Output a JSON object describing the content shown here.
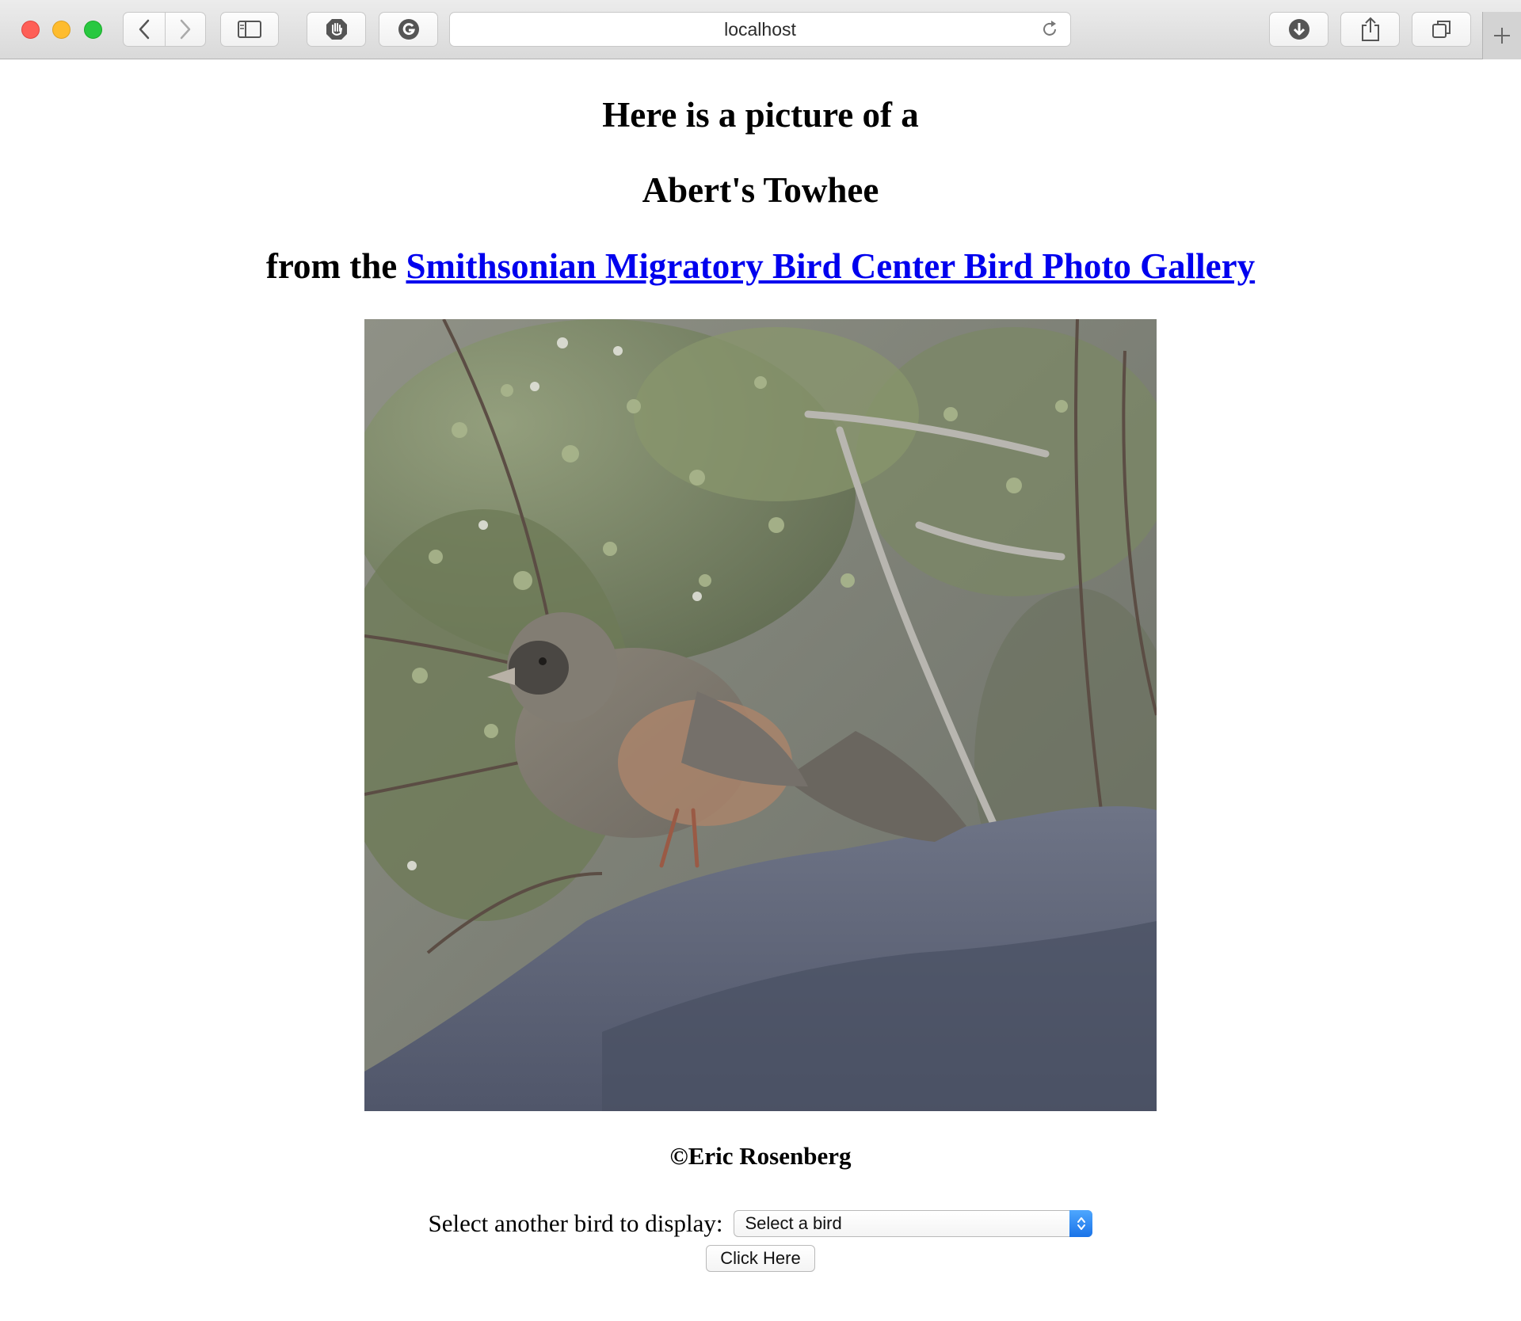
{
  "browser": {
    "url": "localhost"
  },
  "page": {
    "heading_line1": "Here is a picture of a",
    "bird_name": "Abert's Towhee",
    "from_prefix": "from the",
    "gallery_link": "Smithsonian Migratory Bird Center Bird Photo Gallery",
    "credit": "©Eric Rosenberg",
    "select_label": "Select another bird to display:",
    "select_value": "Select a bird",
    "submit_label": "Click Here"
  }
}
